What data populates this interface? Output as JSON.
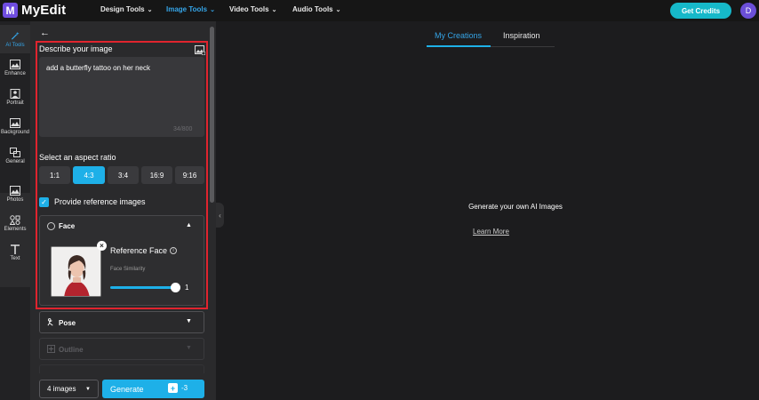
{
  "app": {
    "logo_letter": "M",
    "name": "MyEdit"
  },
  "nav": [
    {
      "label": "Design Tools"
    },
    {
      "label": "Image Tools"
    },
    {
      "label": "Video Tools"
    },
    {
      "label": "Audio Tools"
    }
  ],
  "header": {
    "credits_label": "Get Credits",
    "user_initial": "D"
  },
  "rail": {
    "items": [
      {
        "label": "AI Tools"
      },
      {
        "label": "Enhance"
      },
      {
        "label": "Portrait"
      },
      {
        "label": "Background"
      },
      {
        "label": "General"
      },
      {
        "label": "Photos"
      },
      {
        "label": "Elements"
      },
      {
        "label": "Text"
      }
    ]
  },
  "panel": {
    "describe_label": "Describe your image",
    "prompt_value": "add a butterfly tattoo on her neck",
    "char_counter": "34/800",
    "aspect_label": "Select an aspect ratio",
    "ratios": [
      "1:1",
      "4:3",
      "3:4",
      "16:9",
      "9:16"
    ],
    "selected_ratio": "4:3",
    "reference_label": "Provide reference images",
    "reference_checked": true,
    "face": {
      "title": "Face",
      "ref_title": "Reference Face",
      "similarity_label": "Face Similarity",
      "similarity_value": "1",
      "similarity_fraction": 1
    },
    "pose_title": "Pose",
    "outline_title": "Outline",
    "image_count": "4 images",
    "generate_label": "Generate",
    "generate_cost": "-3"
  },
  "main": {
    "tabs": [
      "My Creations",
      "Inspiration"
    ],
    "active_tab": "My Creations",
    "empty_message": "Generate your own AI Images",
    "learn_more": "Learn More"
  },
  "colors": {
    "accent": "#1eb0e8",
    "brand": "#6f4de0",
    "credits": "#16b8c9",
    "highlight": "#e0242e"
  }
}
